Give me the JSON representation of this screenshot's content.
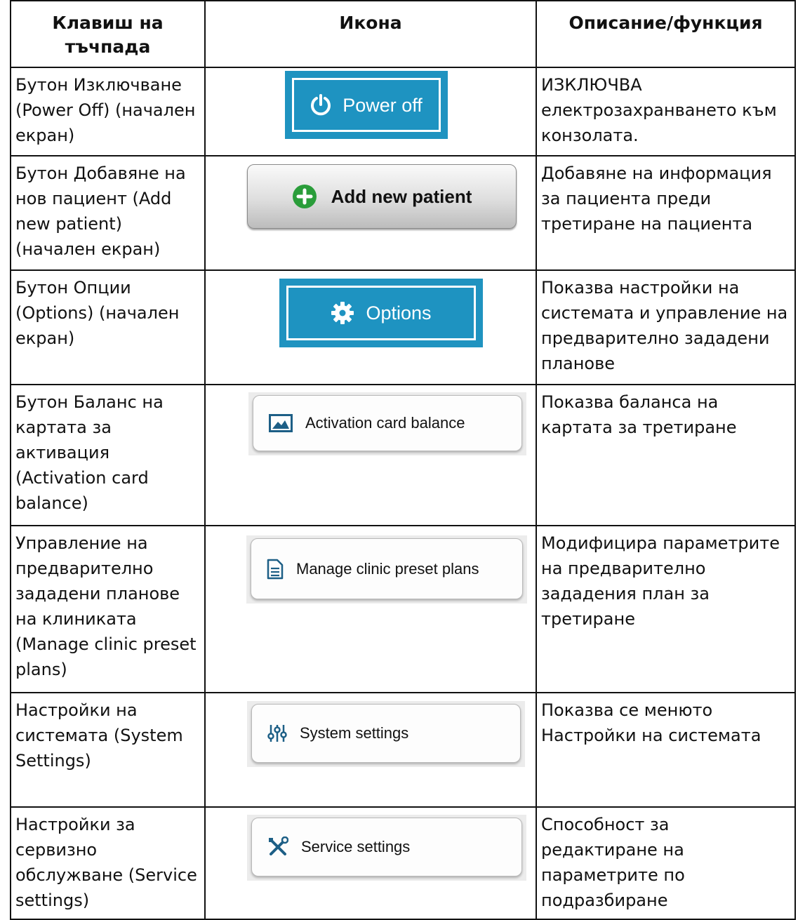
{
  "headers": [
    "Клавиш на тъчпада",
    "Икона",
    "Описание/функция"
  ],
  "rows": [
    {
      "key": "Бутон Изключване (Power Off) (начален екран)",
      "button_label": "Power off",
      "icon": "power-icon",
      "description": "ИЗКЛЮЧВА електрозахранването към конзолата."
    },
    {
      "key": "Бутон Добавяне на нов пациент (Add new patient) (начален екран)",
      "button_label": "Add new patient",
      "icon": "plus-circle-icon",
      "description": "Добавяне на информация за пациента преди третиране на пациента"
    },
    {
      "key": "Бутон Опции (Options) (начален екран)",
      "button_label": "Options",
      "icon": "gear-icon",
      "description": "Показва настройки на системата и управление на предварително зададени планове"
    },
    {
      "key": "Бутон Баланс на картата за активация (Activation card balance)",
      "button_label": "Activation card balance",
      "icon": "card-image-icon",
      "description": "Показва баланса на картата за третиране"
    },
    {
      "key": "Управление на предварително зададени планове на клиниката (Manage clinic preset plans)",
      "button_label": "Manage clinic preset plans",
      "icon": "document-icon",
      "description": "Модифицира параметрите на предварително зададения план за третиране"
    },
    {
      "key": "Настройки на системата (System Settings)",
      "button_label": "System settings",
      "icon": "sliders-icon",
      "description": "Показва се менюто Настройки на системата"
    },
    {
      "key": "Настройки за сервизно обслужване (Service settings)",
      "button_label": "Service settings",
      "icon": "tools-icon",
      "description": "Способност за редактиране на параметрите по подразбиране"
    }
  ],
  "colors": {
    "blue_button": "#1e93c1",
    "green_plus": "#2a9d3a",
    "grid": "#111111"
  }
}
